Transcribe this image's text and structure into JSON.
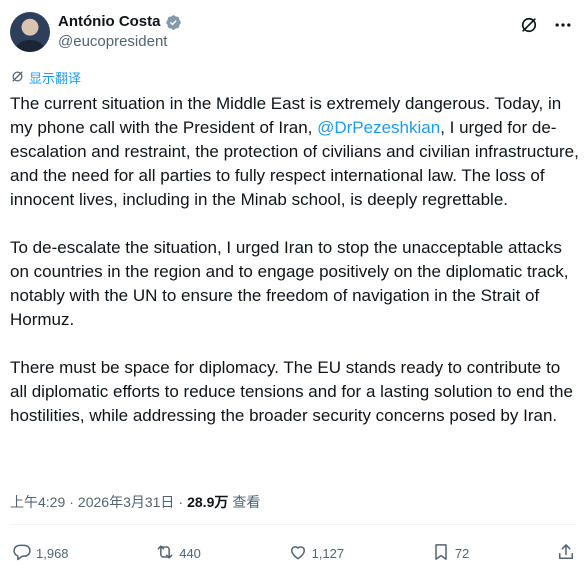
{
  "author": {
    "name": "António Costa",
    "handle": "@eucopresident"
  },
  "translate_label": "显示翻译",
  "tweet": {
    "p1_before": "The current situation in the Middle East is extremely dangerous. Today, in my phone call with the President of Iran, ",
    "p1_mention": "@DrPezeshkian",
    "p1_after": ", I urged for de-escalation and restraint, the protection of civilians and civilian infrastructure, and the need for all parties to fully respect international law. The loss of innocent lives, including in the Minab school, is deeply regrettable.",
    "p2": "To de-escalate the situation, I urged Iran to stop the unacceptable attacks on countries in the region and to engage positively on the diplomatic track, notably with the UN to ensure the freedom of navigation in the Strait of Hormuz.",
    "p3": "There must be space for diplomacy. The EU stands ready to contribute to all diplomatic efforts to reduce tensions and for a lasting solution to end the hostilities, while addressing the broader security concerns posed by Iran."
  },
  "meta": {
    "time": "上午4:29",
    "sep": "·",
    "date": "2026年3月31日",
    "views": "28.9万",
    "views_label": "查看"
  },
  "actions": {
    "replies": "1,968",
    "reposts": "440",
    "likes": "1,127",
    "bookmarks": "72"
  },
  "icons": {
    "verified": "verified-badge-icon",
    "grok": "grok-icon",
    "more": "more-icon",
    "translate": "translate-icon",
    "reply": "reply-icon",
    "repost": "repost-icon",
    "like": "like-icon",
    "bookmark": "bookmark-icon",
    "share": "share-icon"
  },
  "colors": {
    "accent": "#1d9bf0",
    "text": "#0f1419",
    "muted": "#536471",
    "verified": "#829aab"
  }
}
